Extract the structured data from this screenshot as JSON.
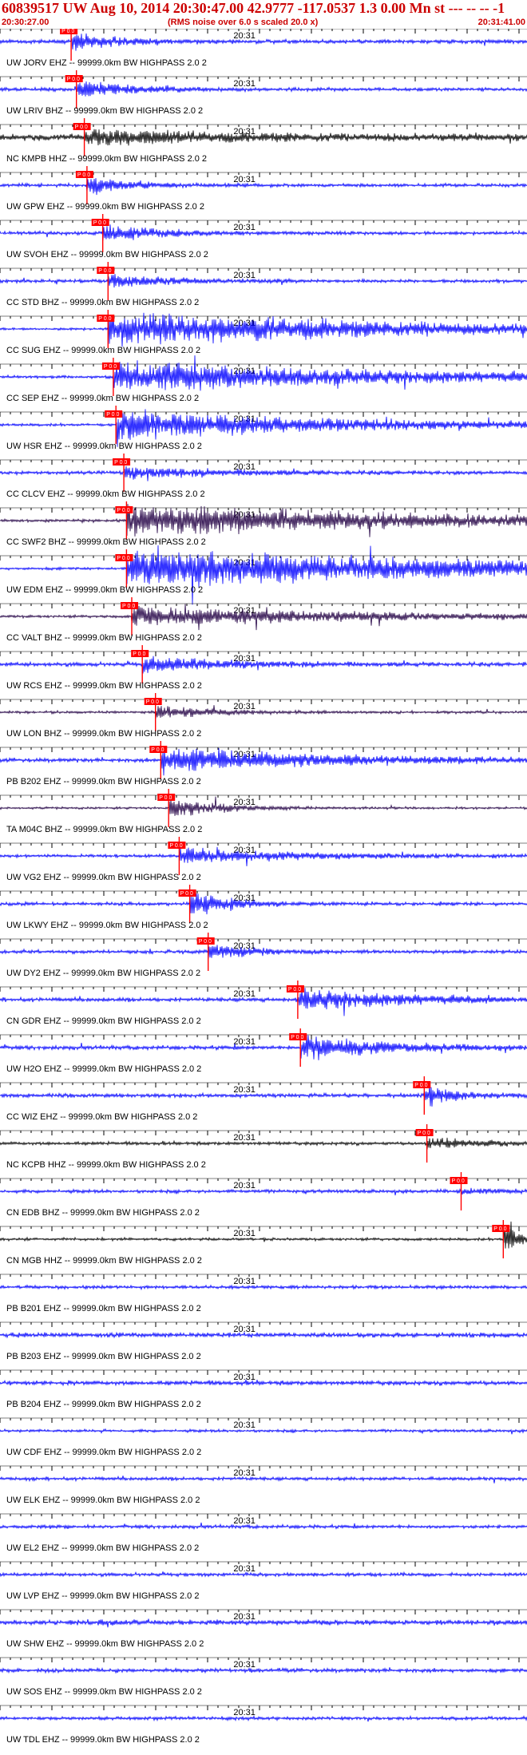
{
  "header": {
    "title": "60839517 UW Aug 10, 2014 20:30:47.00   42.9777 -117.0537  1.3 0.00 Mn st --- -- --  -1",
    "start_time": "20:30:27.00",
    "noise_note": "(RMS noise over 6.0 s scaled 20.0 x)",
    "end_time": "20:31:41.00"
  },
  "minute_label": "20:31",
  "pick_label": "P 0.0",
  "colors": {
    "pick": "#ff0000",
    "label_text": "#000000",
    "header_text": "#cc0000",
    "tick": "#000000"
  },
  "traces": [
    {
      "label": "UW JORV EHZ -- 99999.0km BW  HIGHPASS  2.0  2",
      "color": "#0000ff",
      "pick": 0.135,
      "amp": 0.35,
      "event": 0.55,
      "decay": 0.08
    },
    {
      "label": "UW LRIV BHZ -- 99999.0km BW  HIGHPASS  2.0  2",
      "color": "#0000ff",
      "pick": 0.145,
      "amp": 0.3,
      "event": 0.5,
      "decay": 0.1
    },
    {
      "label": "NC KMPB HHZ -- 99999.0km BW  HIGHPASS  2.0  2",
      "color": "#000000",
      "pick": 0.16,
      "amp": 0.55,
      "event": 0.4,
      "decay": 0.3
    },
    {
      "label": "UW GPW EHZ -- 99999.0km BW  HIGHPASS  2.0  2",
      "color": "#0000ff",
      "pick": 0.165,
      "amp": 0.3,
      "event": 0.55,
      "decay": 0.08
    },
    {
      "label": "UW SVOH EHZ -- 99999.0km BW  HIGHPASS  2.0  2",
      "color": "#0000ff",
      "pick": 0.195,
      "amp": 0.3,
      "event": 0.5,
      "decay": 0.1
    },
    {
      "label": "CC STD BHZ -- 99999.0km BW  HIGHPASS  2.0  2",
      "color": "#0000ff",
      "pick": 0.205,
      "amp": 0.3,
      "event": 0.45,
      "decay": 0.1
    },
    {
      "label": "CC SUG EHZ -- 99999.0km BW  HIGHPASS  2.0  2",
      "color": "#0000ff",
      "pick": 0.205,
      "amp": 0.2,
      "event": 1.0,
      "decay": 0.6
    },
    {
      "label": "CC SEP EHZ -- 99999.0km BW  HIGHPASS  2.0  2",
      "color": "#0000ff",
      "pick": 0.215,
      "amp": 0.25,
      "event": 0.85,
      "decay": 0.55
    },
    {
      "label": "UW HSR EHZ -- 99999.0km BW  HIGHPASS  2.0  2",
      "color": "#0000ff",
      "pick": 0.22,
      "amp": 0.25,
      "event": 0.8,
      "decay": 0.45
    },
    {
      "label": "CC CLCV EHZ -- 99999.0km BW  HIGHPASS  2.0  2",
      "color": "#0000ff",
      "pick": 0.235,
      "amp": 0.3,
      "event": 0.3,
      "decay": 0.2
    },
    {
      "label": "CC SWF2 BHZ -- 99999.0km BW  HIGHPASS  2.0  2",
      "color": "#220044",
      "pick": 0.24,
      "amp": 0.25,
      "event": 0.9,
      "decay": 0.6
    },
    {
      "label": "UW EDM EHZ -- 99999.0km BW  HIGHPASS  2.0  2",
      "color": "#0000ff",
      "pick": 0.24,
      "amp": 0.25,
      "event": 1.0,
      "decay": 0.9
    },
    {
      "label": "CC VALT BHZ -- 99999.0km BW  HIGHPASS  2.0  2",
      "color": "#220044",
      "pick": 0.25,
      "amp": 0.25,
      "event": 0.55,
      "decay": 0.45
    },
    {
      "label": "UW RCS EHZ -- 99999.0km BW  HIGHPASS  2.0  2",
      "color": "#0000ff",
      "pick": 0.27,
      "amp": 0.35,
      "event": 0.45,
      "decay": 0.15
    },
    {
      "label": "UW LON BHZ -- 99999.0km BW  HIGHPASS  2.0  2",
      "color": "#220044",
      "pick": 0.295,
      "amp": 0.25,
      "event": 0.4,
      "decay": 0.1
    },
    {
      "label": "PB B202 EHZ -- 99999.0km BW  HIGHPASS  2.0  2",
      "color": "#0000ff",
      "pick": 0.305,
      "amp": 0.35,
      "event": 0.7,
      "decay": 0.3
    },
    {
      "label": "TA M04C BHZ -- 99999.0km BW  HIGHPASS  2.0  2",
      "color": "#220044",
      "pick": 0.32,
      "amp": 0.2,
      "event": 0.55,
      "decay": 0.1
    },
    {
      "label": "UW VG2 EHZ -- 99999.0km BW  HIGHPASS  2.0  2",
      "color": "#0000ff",
      "pick": 0.34,
      "amp": 0.3,
      "event": 0.45,
      "decay": 0.2
    },
    {
      "label": "UW LKWY EHZ -- 99999.0km BW  HIGHPASS  2.0  2",
      "color": "#0000ff",
      "pick": 0.36,
      "amp": 0.3,
      "event": 0.85,
      "decay": 0.07
    },
    {
      "label": "UW DY2 EHZ -- 99999.0km BW  HIGHPASS  2.0  2",
      "color": "#0000ff",
      "pick": 0.395,
      "amp": 0.3,
      "event": 0.5,
      "decay": 0.08
    },
    {
      "label": "CN GDR EHZ -- 99999.0km BW  HIGHPASS  2.0  2",
      "color": "#0000ff",
      "pick": 0.565,
      "amp": 0.35,
      "event": 0.6,
      "decay": 0.2
    },
    {
      "label": "UW H2O EHZ -- 99999.0km BW  HIGHPASS  2.0  2",
      "color": "#0000ff",
      "pick": 0.57,
      "amp": 0.35,
      "event": 0.75,
      "decay": 0.15
    },
    {
      "label": "CC WIZ EHZ -- 99999.0km BW  HIGHPASS  2.0  2",
      "color": "#0000ff",
      "pick": 0.805,
      "amp": 0.35,
      "event": 0.6,
      "decay": 0.06
    },
    {
      "label": "NC KCPB HHZ -- 99999.0km BW  HIGHPASS  2.0  2",
      "color": "#000000",
      "pick": 0.81,
      "amp": 0.3,
      "event": 0.35,
      "decay": 0.1
    },
    {
      "label": "CN EDB BHZ -- 99999.0km BW  HIGHPASS  2.0  2",
      "color": "#0000ff",
      "pick": 0.875,
      "amp": 0.3,
      "event": 0.2,
      "decay": 0.05
    },
    {
      "label": "CN MGB HHZ -- 99999.0km BW  HIGHPASS  2.0  2",
      "color": "#000000",
      "pick": 0.955,
      "amp": 0.25,
      "event": 0.9,
      "decay": 0.03
    },
    {
      "label": "PB B201 EHZ -- 99999.0km BW  HIGHPASS  2.0  2",
      "color": "#0000ff",
      "pick": null,
      "amp": 0.3,
      "event": 0,
      "decay": 0
    },
    {
      "label": "PB B203 EHZ -- 99999.0km BW  HIGHPASS  2.0  2",
      "color": "#0000ff",
      "pick": null,
      "amp": 0.4,
      "event": 0,
      "decay": 0
    },
    {
      "label": "PB B204 EHZ -- 99999.0km BW  HIGHPASS  2.0  2",
      "color": "#0000ff",
      "pick": null,
      "amp": 0.4,
      "event": 0,
      "decay": 0
    },
    {
      "label": "UW CDF EHZ -- 99999.0km BW  HIGHPASS  2.0  2",
      "color": "#0000ff",
      "pick": null,
      "amp": 0.25,
      "event": 0,
      "decay": 0
    },
    {
      "label": "UW ELK EHZ -- 99999.0km BW  HIGHPASS  2.0  2",
      "color": "#0000ff",
      "pick": null,
      "amp": 0.3,
      "event": 0,
      "decay": 0
    },
    {
      "label": "UW EL2 EHZ -- 99999.0km BW  HIGHPASS  2.0  2",
      "color": "#0000ff",
      "pick": null,
      "amp": 0.3,
      "event": 0,
      "decay": 0
    },
    {
      "label": "UW LVP EHZ -- 99999.0km BW  HIGHPASS  2.0  2",
      "color": "#0000ff",
      "pick": null,
      "amp": 0.3,
      "event": 0,
      "decay": 0
    },
    {
      "label": "UW SHW EHZ -- 99999.0km BW  HIGHPASS  2.0  2",
      "color": "#0000ff",
      "pick": null,
      "amp": 0.45,
      "event": 0,
      "decay": 0
    },
    {
      "label": "UW SOS EHZ -- 99999.0km BW  HIGHPASS  2.0  2",
      "color": "#0000ff",
      "pick": null,
      "amp": 0.35,
      "event": 0,
      "decay": 0
    },
    {
      "label": "UW TDL EHZ -- 99999.0km BW  HIGHPASS  2.0  2",
      "color": "#0000ff",
      "pick": null,
      "amp": 0.3,
      "event": 0,
      "decay": 0
    }
  ]
}
